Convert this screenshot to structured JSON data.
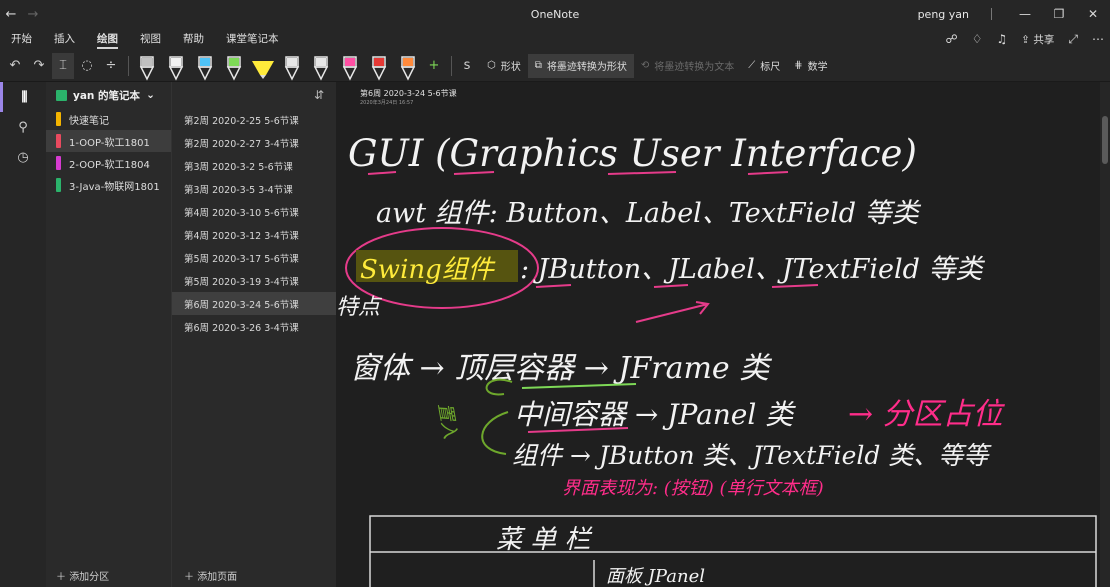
{
  "titlebar": {
    "app_title": "OneNote",
    "user_name": "peng yan",
    "back_icon": "back-arrow-icon",
    "forward_icon": "forward-arrow-icon"
  },
  "menu": {
    "items": [
      "开始",
      "插入",
      "绘图",
      "视图",
      "帮助",
      "课堂笔记本"
    ],
    "active": "绘图",
    "share_label": "共享"
  },
  "toolbar": {
    "pens": [
      {
        "color": "#c0c0c0",
        "type": "pen-icon"
      },
      {
        "color": "#f2f2f2",
        "type": "pen-icon"
      },
      {
        "color": "#4fc3f7",
        "type": "pen-icon"
      },
      {
        "color": "#7ed957",
        "type": "pen-icon"
      },
      {
        "color": "#ffeb3b",
        "type": "highlighter-icon"
      },
      {
        "color": "#e6e6e6",
        "type": "pen-icon"
      },
      {
        "color": "#e6e6e6",
        "type": "pen-icon"
      },
      {
        "color": "#ff4fa3",
        "type": "pen-icon"
      },
      {
        "color": "#e53935",
        "type": "pen-icon"
      },
      {
        "color": "#ff8a3c",
        "type": "pen-icon"
      }
    ],
    "shapes_label": "形状",
    "ink_to_shape_label": "将墨迹转换为形状",
    "ink_to_text_label": "将墨迹转换为文本",
    "ruler_label": "标尺",
    "math_label": "数学"
  },
  "notebook": {
    "name": "yan 的笔记本",
    "sections": [
      {
        "label": "快速笔记",
        "color": "#f4b400"
      },
      {
        "label": "1-OOP-软工1801",
        "color": "#e84a5f"
      },
      {
        "label": "2-OOP-软工1804",
        "color": "#d63bd0"
      },
      {
        "label": "3-Java-物联网1801",
        "color": "#2bb36b"
      }
    ],
    "selected_section": 1,
    "add_section_label": "添加分区"
  },
  "pages": {
    "items": [
      "第2周 2020-2-25 5-6节课",
      "第2周 2020-2-27 3-4节课",
      "第3周 2020-3-2 5-6节课",
      "第3周 2020-3-5 3-4节课",
      "第4周 2020-3-10 5-6节课",
      "第4周 2020-3-12 3-4节课",
      "第5周 2020-3-17 5-6节课",
      "第5周 2020-3-19 3-4节课",
      "第6周 2020-3-24 5-6节课",
      "第6周 2020-3-26 3-4节课"
    ],
    "selected_page": 8,
    "add_page_label": "添加页面"
  },
  "note": {
    "page_title": "第6周 2020-3-24 5-6节课",
    "page_date": "2020年3月24日 16:57",
    "ink_lines": {
      "gui_line": "GUI (Graphics User Interface)",
      "awt_line": "awt 组件: Button、Label、TextField 等类",
      "swing_label": "Swing组件",
      "swing_line": ": JButton、JLabel、JTextField 等类",
      "feature_label": "特点",
      "jframe_line": "窗体 → 顶层容器 → JFrame 类",
      "jpanel_line": "中间容器 → JPanel 类",
      "jpanel_note": "→ 分区占位",
      "component_line": "组件 → JButton 类、JTextField 类、等等",
      "display_note": "界面表现为: (按钮)     (单行文本框)",
      "place_note": "置入",
      "menubar_label": "菜 单 栏",
      "bottom_text": "面板 JPanel"
    }
  }
}
